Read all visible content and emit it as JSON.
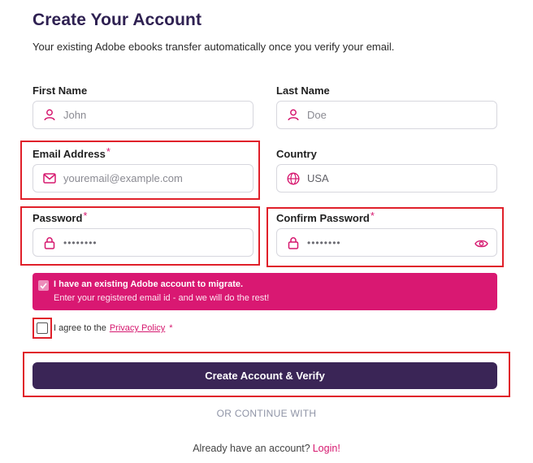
{
  "header": {
    "title": "Create Your Account",
    "subtitle": "Your existing Adobe ebooks transfer automatically once you verify your email."
  },
  "form": {
    "first_name": {
      "label": "First Name",
      "placeholder": "John",
      "icon": "user-icon"
    },
    "last_name": {
      "label": "Last Name",
      "placeholder": "Doe",
      "icon": "user-icon"
    },
    "email": {
      "label": "Email Address",
      "required_mark": "*",
      "placeholder": "youremail@example.com",
      "icon": "mail-icon"
    },
    "country": {
      "label": "Country",
      "value": "USA",
      "icon": "globe-icon"
    },
    "password": {
      "label": "Password",
      "required_mark": "*",
      "value": "••••••••",
      "icon": "lock-icon"
    },
    "confirm_password": {
      "label": "Confirm Password",
      "required_mark": "*",
      "value": "••••••••",
      "icon": "lock-icon",
      "toggle_icon": "eye-icon"
    }
  },
  "migrate": {
    "checked": true,
    "line1": "I have an existing Adobe account to migrate.",
    "line2": "Enter your registered email id - and we will do the rest!"
  },
  "agree": {
    "checked": false,
    "text": "I agree to the",
    "link": "Privacy Policy",
    "required_mark": "*"
  },
  "submit_label": "Create Account & Verify",
  "divider_text": "OR CONTINUE WITH",
  "footer": {
    "text": "Already have an account?",
    "link": "Login!"
  },
  "colors": {
    "title": "#2f2152",
    "accent": "#d6186f",
    "button": "#3a2556",
    "highlight": "#e0202a"
  }
}
